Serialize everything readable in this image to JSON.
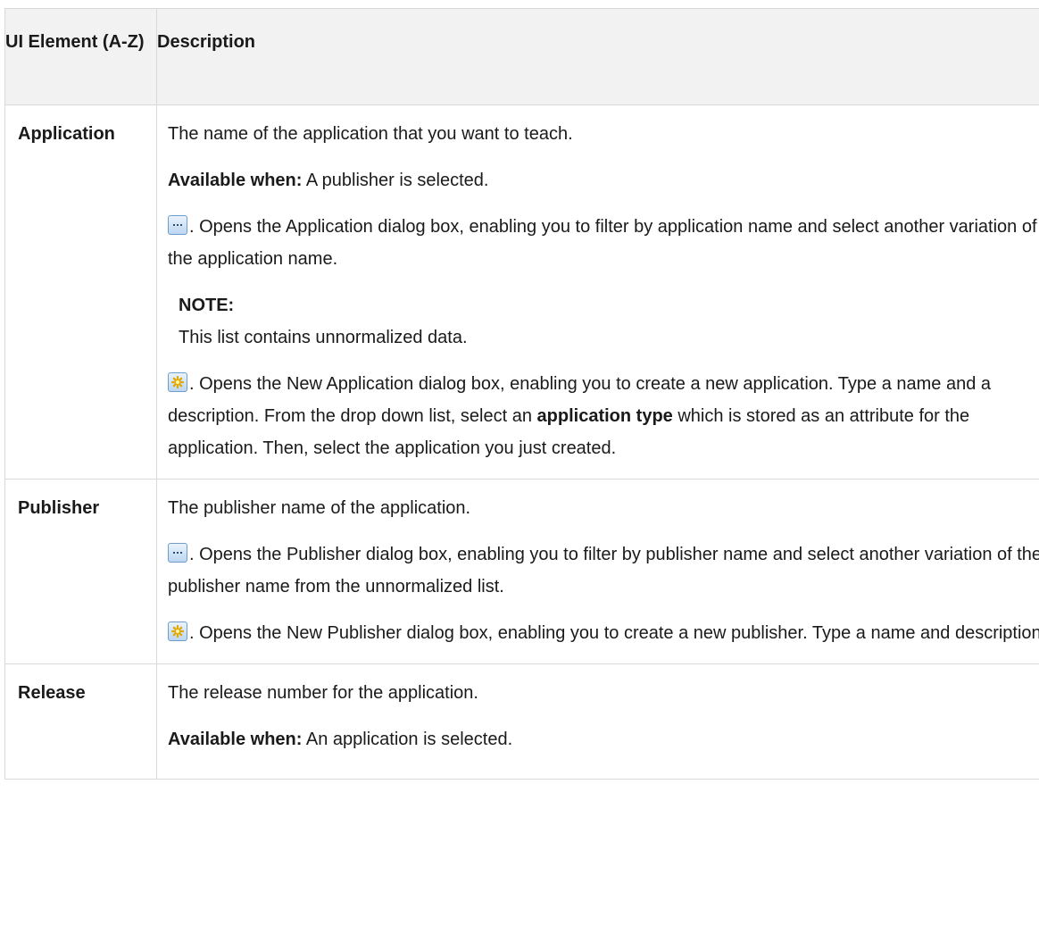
{
  "header": {
    "col_element": "UI Element (A-Z)",
    "col_description": "Description"
  },
  "icons": {
    "browse": "ellipsis-button-icon",
    "new": "new-item-star-icon"
  },
  "rows": [
    {
      "element": "Application",
      "intro": "The name of the application that you want to teach.",
      "available_label": "Available when:",
      "available_text": " A publisher is selected.",
      "browse_text": ". Opens the Application dialog box, enabling you to filter by application name and select another variation of the application name.",
      "note_title": "NOTE:",
      "note_text": "This list contains unnormalized data.",
      "new_text_1": ". Opens the New Application dialog box, enabling you to create a new application. Type a name and a description. From the drop down list, select an ",
      "new_bold": "application type",
      "new_text_2": " which is stored as an attribute for the application. Then, select the application you just created."
    },
    {
      "element": "Publisher",
      "intro": "The publisher name of the application.",
      "browse_text": ". Opens the Publisher dialog box, enabling you to filter by publisher name and select another variation of the publisher name from the unnormalized list.",
      "new_text": ". Opens the New Publisher dialog box, enabling you to create a new publisher. Type a name and description."
    },
    {
      "element": "Release",
      "intro": "The release number for the application.",
      "available_label": "Available when:",
      "available_text": " An application is selected."
    }
  ]
}
